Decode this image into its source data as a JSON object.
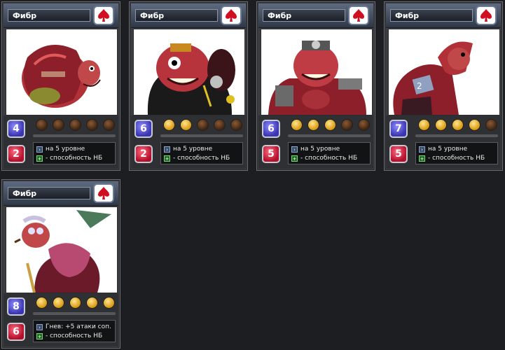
{
  "cards": [
    {
      "name": "Фибр",
      "level": "4",
      "damage": "2",
      "stars_on": 0,
      "stars_total": 5,
      "ability_line1": "на 5 уровне",
      "ability_line2": "- способность НБ",
      "icon": "character-portrait"
    },
    {
      "name": "Фибр",
      "level": "6",
      "damage": "2",
      "stars_on": 2,
      "stars_total": 5,
      "ability_line1": "на 5 уровне",
      "ability_line2": "- способность НБ",
      "icon": "character-portrait"
    },
    {
      "name": "Фибр",
      "level": "6",
      "damage": "5",
      "stars_on": 3,
      "stars_total": 5,
      "ability_line1": "на 5 уровне",
      "ability_line2": "- способность НБ",
      "icon": "character-portrait"
    },
    {
      "name": "Фибр",
      "level": "7",
      "damage": "5",
      "stars_on": 4,
      "stars_total": 5,
      "ability_line1": "на 5 уровне",
      "ability_line2": "- способность НБ",
      "icon": "character-portrait"
    },
    {
      "name": "Фибр",
      "level": "8",
      "damage": "6",
      "stars_on": 5,
      "stars_total": 5,
      "ability_line1": "Гнев: +5 атаки соп.",
      "ability_line2": "- способность НБ",
      "icon": "character-portrait"
    }
  ],
  "colors": {
    "background": "#1d1e22",
    "level_gem": "#3a35b0",
    "damage_gem": "#b3102a",
    "star_on": "#d8980e",
    "star_off": "#3f2410",
    "suit": "#d01020"
  },
  "suit_icon": "spade-icon"
}
